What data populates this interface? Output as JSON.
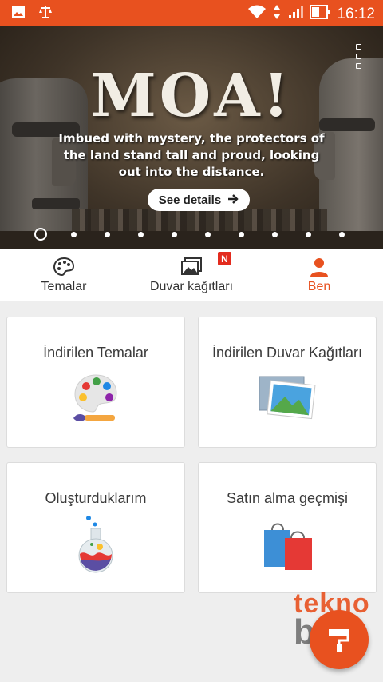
{
  "status_bar": {
    "time": "16:12",
    "left_icons": [
      "image-icon",
      "scale-icon"
    ],
    "right_icons": [
      "wifi-icon",
      "data-arrows-icon",
      "signal-icon",
      "battery-icon"
    ],
    "color": "#e8511f"
  },
  "banner": {
    "title": "MOA!",
    "text": "Imbued with mystery, the protectors of the land stand tall and proud, looking out into the distance.",
    "button_label": "See details",
    "page_count": 10,
    "active_page": 1
  },
  "tabs": [
    {
      "label": "Temalar",
      "icon": "palette-icon",
      "active": false
    },
    {
      "label": "Duvar kağıtları",
      "icon": "wallpaper-icon",
      "active": false,
      "badge": "N"
    },
    {
      "label": "Ben",
      "icon": "person-icon",
      "active": true
    }
  ],
  "cards": [
    {
      "title": "İndirilen Temalar",
      "icon": "palette-brush-icon"
    },
    {
      "title": "İndirilen Duvar Kağıtları",
      "icon": "picture-icon"
    },
    {
      "title": "Oluşturduklarım",
      "icon": "flask-icon"
    },
    {
      "title": "Satın alma geçmişi",
      "icon": "shopping-bags-icon"
    }
  ],
  "watermark": {
    "line1": "tekno",
    "line2": "blog"
  },
  "colors": {
    "accent": "#e8511f",
    "badge": "#e32b1e"
  }
}
